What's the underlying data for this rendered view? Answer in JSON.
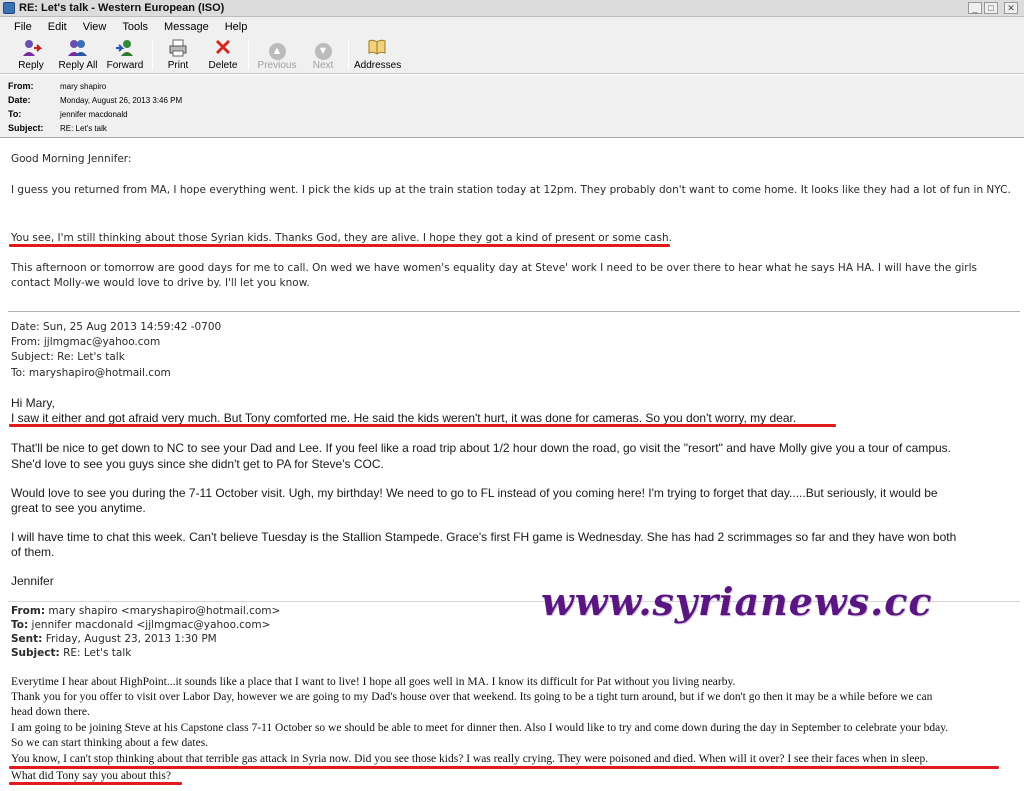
{
  "window": {
    "title": "RE: Let's talk - Western European (ISO)",
    "controls": [
      "_",
      "□",
      "✕"
    ]
  },
  "menu": [
    "File",
    "Edit",
    "View",
    "Tools",
    "Message",
    "Help"
  ],
  "toolbar": {
    "reply": "Reply",
    "reply_all": "Reply All",
    "forward": "Forward",
    "print": "Print",
    "delete": "Delete",
    "previous": "Previous",
    "next": "Next",
    "addresses": "Addresses"
  },
  "headers": {
    "from_label": "From:",
    "from": "mary shapiro",
    "date_label": "Date:",
    "date": "Monday, August 26, 2013 3:46 PM",
    "to_label": "To:",
    "to": "jennifer macdonald",
    "subject_label": "Subject:",
    "subject": "RE: Let's talk"
  },
  "message": {
    "greeting": "Good Morning Jennifer:",
    "p1": "I guess you returned from MA, I hope everything went.  I pick the kids up at the train station today at 12pm.  They probably don't want to come home.  It looks like they had a lot of fun in NYC.",
    "p2": "You see, I'm still thinking about those Syrian kids. Thanks God, they are alive. I hope they got a kind of present or some cash.",
    "p3_l1": "This afternoon or tomorrow are good days for me to call.  On wed we have women's equality day at Steve' work I need to be over there to hear what he says HA HA.  I will have the girls",
    "p3_l2": "contact Molly-we would love to drive by.  I'll let you know.",
    "q1_date": "Date: Sun, 25 Aug 2013 14:59:42 -0700",
    "q1_from": "From: jjlmgmac@yahoo.com",
    "q1_subject": "Subject: Re: Let's talk",
    "q1_to": "To: maryshapiro@hotmail.com",
    "q1_hi": "Hi Mary,",
    "q1_p1": "I saw it either and got afraid very much. But Tony comforted me. He said the kids weren't hurt, it was done for cameras. So you don't worry, my dear.",
    "q1_p2_l1": "That'll be nice to get down to NC to see your Dad and Lee.  If you feel like a road trip about 1/2 hour down the road, go visit the \"resort\" and have Molly give you a tour of campus.",
    "q1_p2_l2": "She'd love to see you guys since she didn't get to PA for Steve's COC.",
    "q1_p3_l1": "Would love to see you during the 7-11 October visit.  Ugh, my birthday!  We need to go to FL instead of you coming here!  I'm trying to forget that day.....But seriously, it would be",
    "q1_p3_l2": "great to see you anytime.",
    "q1_p4_l1": "I will have time to chat this week.  Can't believe Tuesday is the Stallion Stampede.  Grace's first FH game is Wednesday.  She has had 2 scrimmages so far and they have won both",
    "q1_p4_l2": "of them.",
    "q1_sign": "Jennifer",
    "q2_from_label": "From:",
    "q2_from": "mary shapiro <maryshapiro@hotmail.com>",
    "q2_to_label": "To:",
    "q2_to": "jennifer macdonald <jjlmgmac@yahoo.com>",
    "q2_sent_label": "Sent:",
    "q2_sent": "Friday, August 23, 2013 1:30 PM",
    "q2_subject_label": "Subject:",
    "q2_subject": "RE: Let's talk",
    "q2_l1": "Everytime I hear about HighPoint...it sounds like a place that I want to live!  I hope all goes well in MA.  I know its difficult for Pat without you living nearby.",
    "q2_l2": "Thank you for you offer to visit over Labor Day, however we are going to my Dad's house over that weekend.  Its going to be a tight turn around, but if we don't go then it may be a while before we can",
    "q2_l3": "head down there.",
    "q2_l4": "I am going to be joining Steve at his Capstone class 7-11 October so we should be able to meet for dinner then.  Also I would like to try and come down during the day in September to celebrate your bday.",
    "q2_l5": " So we can start thinking about a few dates.",
    "q2_l6": "You know, I can't stop thinking about that terrible gas attack in Syria now. Did you see those kids? I was really crying. They were poisoned and died. When will it over? I see their faces when in sleep.",
    "q2_l7": "What did Tony say you about this?"
  },
  "watermark": "www.syrianews.cc",
  "colors": {
    "underline": "#e01b1b",
    "watermark": "#5a1680"
  }
}
